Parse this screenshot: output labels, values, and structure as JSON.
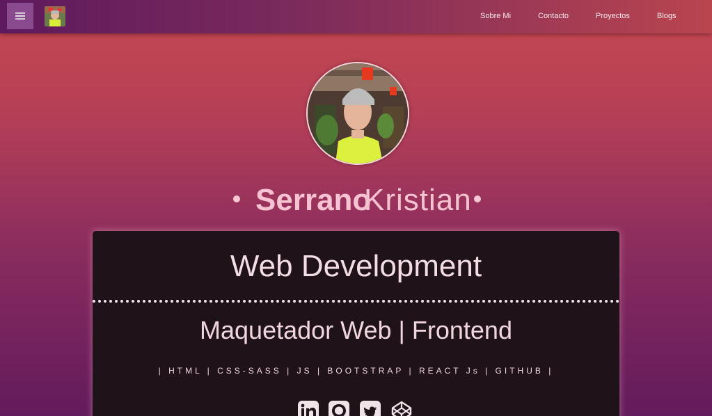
{
  "nav": {
    "links": [
      "Sobre Mi",
      "Contacto",
      "Proyectos",
      "Blogs"
    ]
  },
  "profile": {
    "last_name": "Serrano",
    "first_name": "Kristian"
  },
  "card": {
    "title": "Web Development",
    "subtitle": "Maquetador Web | Frontend",
    "skills": "| HTML | CSS-SASS | JS | BOOTSTRAP | REACT Js | GITHUB |"
  },
  "socials": [
    "linkedin-icon",
    "github-icon",
    "twitter-icon",
    "codepen-icon"
  ],
  "colors": {
    "navbar_start": "#5e1a5d",
    "navbar_end": "#b9454f",
    "card_bg": "#1f1219",
    "accent_pink": "#f7c2d2"
  }
}
